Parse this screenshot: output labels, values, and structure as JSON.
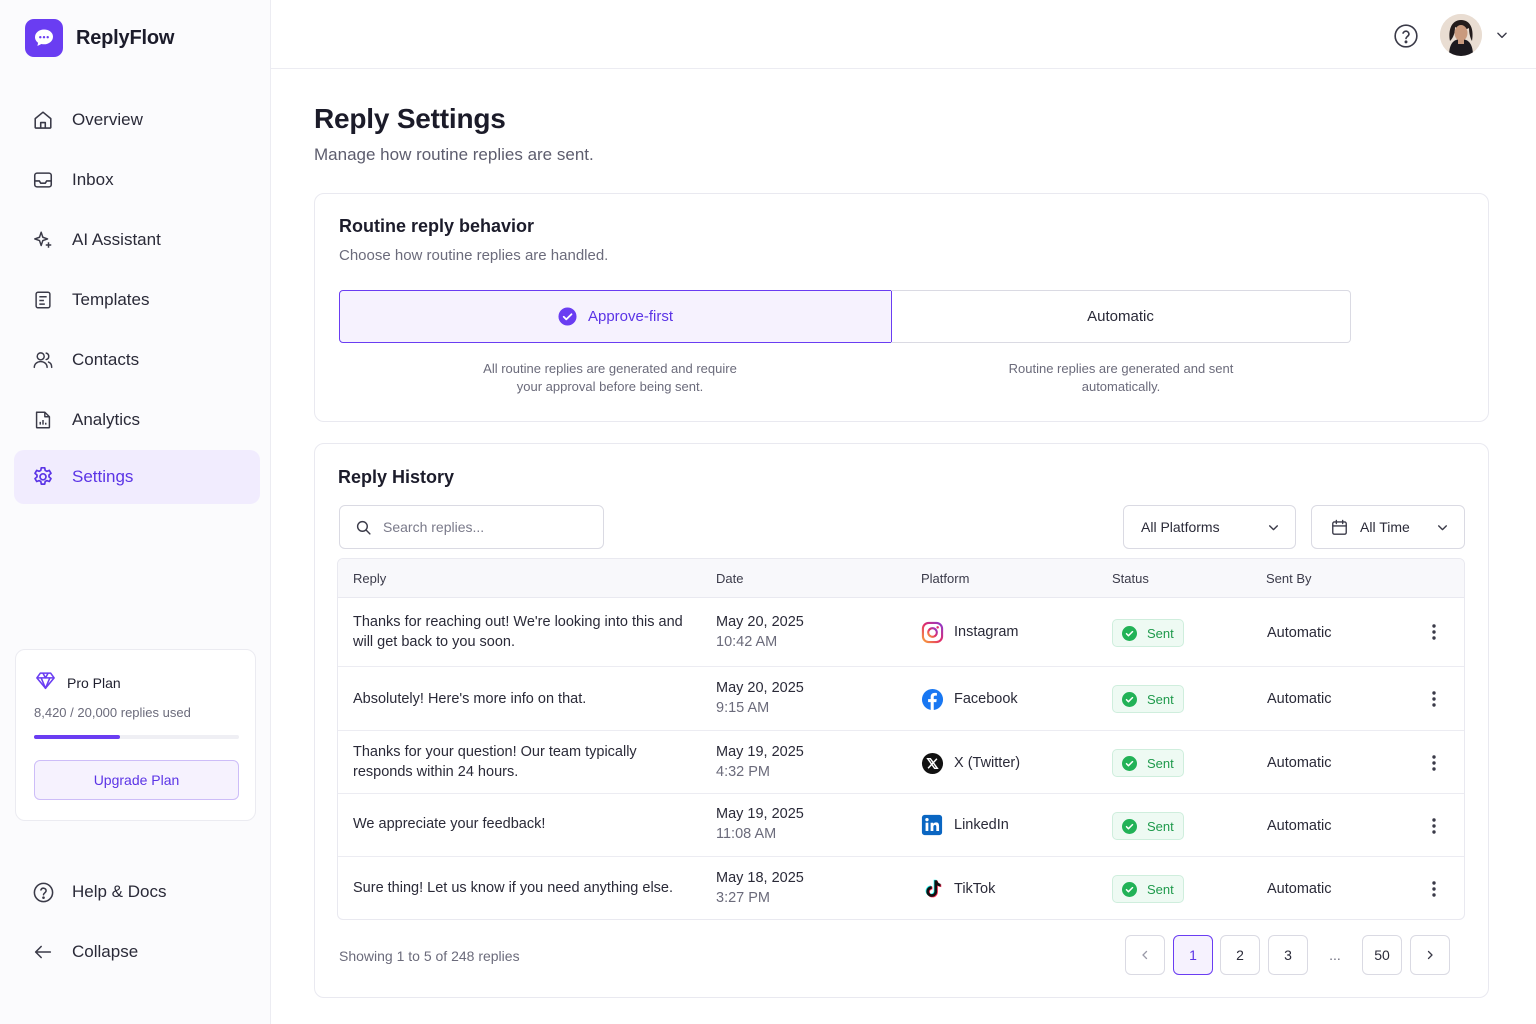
{
  "app": {
    "name": "ReplyFlow"
  },
  "sidebar": {
    "items": [
      {
        "label": "Overview",
        "icon": "home-icon"
      },
      {
        "label": "Inbox",
        "icon": "inbox-icon"
      },
      {
        "label": "AI Assistant",
        "icon": "sparkles-icon"
      },
      {
        "label": "Templates",
        "icon": "template-icon"
      },
      {
        "label": "Contacts",
        "icon": "users-icon"
      },
      {
        "label": "Analytics",
        "icon": "analytics-icon"
      },
      {
        "label": "Settings",
        "icon": "gear-icon",
        "active": true
      }
    ],
    "footer": [
      {
        "label": "Help & Docs",
        "icon": "help-icon"
      },
      {
        "label": "Collapse",
        "icon": "arrow-left-icon"
      }
    ],
    "plan": {
      "name": "Pro Plan",
      "usage_text": "8,420 / 20,000 replies used",
      "used": 8420,
      "limit": 20000,
      "upgrade_label": "Upgrade Plan"
    }
  },
  "page": {
    "title": "Reply Settings",
    "subtitle": "Manage how routine replies are sent."
  },
  "behavior": {
    "title": "Routine reply behavior",
    "subtitle": "Choose how routine replies are handled.",
    "options": [
      {
        "label": "Approve-first",
        "selected": true,
        "description": "All routine replies are generated and require your approval before being sent."
      },
      {
        "label": "Automatic",
        "selected": false,
        "description": "Routine replies are generated and sent automatically."
      }
    ]
  },
  "history": {
    "title": "Reply History",
    "search_placeholder": "Search replies...",
    "platform_filter": "All Platforms",
    "time_filter": "All Time",
    "columns": [
      "Reply",
      "Date",
      "Platform",
      "Status",
      "Sent By"
    ],
    "rows": [
      {
        "reply": "Thanks for reaching out! We're looking into this and will get back to you soon.",
        "date": "May 20, 2025",
        "time": "10:42 AM",
        "platform": "Instagram",
        "platform_icon": "instagram-icon",
        "status": "Sent",
        "sent_by": "Automatic"
      },
      {
        "reply": "Absolutely! Here's more info on that.",
        "date": "May 20, 2025",
        "time": "9:15 AM",
        "platform": "Facebook",
        "platform_icon": "facebook-icon",
        "status": "Sent",
        "sent_by": "Automatic"
      },
      {
        "reply": "Thanks for your question! Our team typically responds within 24 hours.",
        "date": "May 19, 2025",
        "time": "4:32 PM",
        "platform": "X (Twitter)",
        "platform_icon": "x-twitter-icon",
        "status": "Sent",
        "sent_by": "Automatic"
      },
      {
        "reply": "We appreciate your feedback!",
        "date": "May 19, 2025",
        "time": "11:08 AM",
        "platform": "LinkedIn",
        "platform_icon": "linkedin-icon",
        "status": "Sent",
        "sent_by": "Automatic"
      },
      {
        "reply": "Sure thing! Let us know if you need anything else.",
        "date": "May 18, 2025",
        "time": "3:27 PM",
        "platform": "TikTok",
        "platform_icon": "tiktok-icon",
        "status": "Sent",
        "sent_by": "Automatic"
      }
    ],
    "showing_text": "Showing 1 to 5 of 248 replies",
    "pagination": {
      "pages": [
        "1",
        "2",
        "3",
        "...",
        "50"
      ],
      "current": "1"
    }
  },
  "colors": {
    "accent": "#6a3df2",
    "accent_text": "#5b34e6",
    "success": "#22b257",
    "border": "#e9e9f0"
  }
}
